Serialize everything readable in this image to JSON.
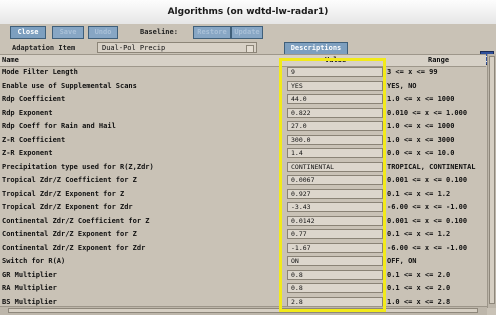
{
  "window": {
    "title": "Algorithms (on wdtd-lw-radar1)"
  },
  "toolbar": {
    "close_label": "Close",
    "save_label": "Save",
    "undo_label": "Undo",
    "baseline_label": "Baseline:",
    "restore_label": "Restore",
    "update_label": "Update"
  },
  "adaptation": {
    "label": "Adaptation Item",
    "selected": "Dual-Pol Precip",
    "descriptions_label": "Descriptions"
  },
  "table": {
    "headers": {
      "name": "Name",
      "value": "Value",
      "range": "Range"
    },
    "rows": [
      {
        "name": "Mode Filter Length",
        "value": "9",
        "range": "3 <= x <= 99"
      },
      {
        "name": "Enable use of Supplemental Scans",
        "value": "YES",
        "range": "YES, NO"
      },
      {
        "name": "Rdp Coefficient",
        "value": "44.0",
        "range": "1.0 <= x <= 1000"
      },
      {
        "name": "Rdp Exponent",
        "value": "0.822",
        "range": "0.010 <= x <= 1.000"
      },
      {
        "name": "Rdp Coeff for Rain and Hail",
        "value": "27.0",
        "range": "1.0 <= x <= 1000"
      },
      {
        "name": "Z-R Coefficient",
        "value": "300.0",
        "range": "1.0 <= x <= 3000"
      },
      {
        "name": "Z-R Exponent",
        "value": "1.4",
        "range": "0.0 <= x <= 10.0"
      },
      {
        "name": "Precipitation type used for R(Z,Zdr)",
        "value": "CONTINENTAL",
        "range": "TROPICAL, CONTINENTAL"
      },
      {
        "name": "Tropical Zdr/Z Coefficient for Z",
        "value": "0.0067",
        "range": "0.001 <= x <= 0.100"
      },
      {
        "name": "Tropical Zdr/Z Exponent for Z",
        "value": "0.927",
        "range": "0.1 <= x <= 1.2"
      },
      {
        "name": "Tropical Zdr/Z Exponent for Zdr",
        "value": "-3.43",
        "range": "-6.00 <= x <= -1.00"
      },
      {
        "name": "Continental Zdr/Z Coefficient for Z",
        "value": "0.0142",
        "range": "0.001 <= x <= 0.100"
      },
      {
        "name": "Continental Zdr/Z Exponent for Z",
        "value": "0.77",
        "range": "0.1 <= x <= 1.2"
      },
      {
        "name": "Continental Zdr/Z Exponent for Zdr",
        "value": "-1.67",
        "range": "-6.00 <= x <= -1.00"
      },
      {
        "name": "Switch for R(A)",
        "value": "ON",
        "range": "OFF, ON"
      },
      {
        "name": "GR Multiplier",
        "value": "0.8",
        "range": "0.1 <= x <= 2.0"
      },
      {
        "name": "RA Multiplier",
        "value": "0.8",
        "range": "0.1 <= x <= 2.0"
      },
      {
        "name": "BS Multiplier",
        "value": "2.8",
        "range": "1.0 <= x <= 2.8"
      }
    ]
  },
  "colors": {
    "background": "#c9c2b6",
    "button": "#7d9fbf",
    "highlight": "#f2ea1a"
  }
}
